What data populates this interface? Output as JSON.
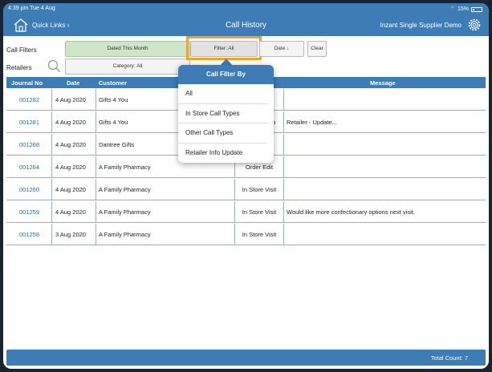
{
  "status": {
    "time": "4:39 pm  Tue 4 Aug",
    "battery": "15%"
  },
  "header": {
    "quick_links": "Quick Links ›",
    "title": "Call History",
    "supplier": "Inzant Single Supplier Demo"
  },
  "filters": {
    "call_filters_label": "Call Filters",
    "retailers_label": "Retailers",
    "dated": "Dated This Month",
    "category": "Category: All",
    "filter": "Filter: All",
    "date_sort": "Date ↓",
    "clear": "Clear"
  },
  "table": {
    "headers": {
      "journal": "Journal No",
      "date": "Date",
      "customer": "Customer",
      "message": "Message"
    },
    "rows": [
      {
        "journal": "001282",
        "date": "4 Aug 2020",
        "customer": "Gifts 4 You",
        "type": "Order Edit",
        "message": ""
      },
      {
        "journal": "001281",
        "date": "4 Aug 2020",
        "customer": "Gifts 4 You",
        "type": "Retailer Info",
        "message": "Retailer - Update..."
      },
      {
        "journal": "001268",
        "date": "4 Aug 2020",
        "customer": "Dantree Gifts",
        "type": "Order Edit",
        "message": ""
      },
      {
        "journal": "001264",
        "date": "4 Aug 2020",
        "customer": "A Family Pharmacy",
        "type": "Order Edit",
        "message": ""
      },
      {
        "journal": "001260",
        "date": "4 Aug 2020",
        "customer": "A Family Pharmacy",
        "type": "In Store Visit",
        "message": ""
      },
      {
        "journal": "001259",
        "date": "4 Aug 2020",
        "customer": "A Family Pharmacy",
        "type": "In Store Visit",
        "message": "Would like more confectionary options next visit."
      },
      {
        "journal": "001258",
        "date": "3 Aug 2020",
        "customer": "A Family Pharmacy",
        "type": "In Store Visit",
        "message": ""
      }
    ]
  },
  "footer": {
    "total": "Total Count: 7"
  },
  "popover": {
    "title": "Call Filter By",
    "items": [
      "All",
      "In Store Call Types",
      "Other Call Types",
      "Retailer Info Update"
    ]
  },
  "colors": {
    "accent": "#3d7cb5",
    "highlight": "#f7a21a",
    "dated_bg": "#cfe6c9"
  }
}
